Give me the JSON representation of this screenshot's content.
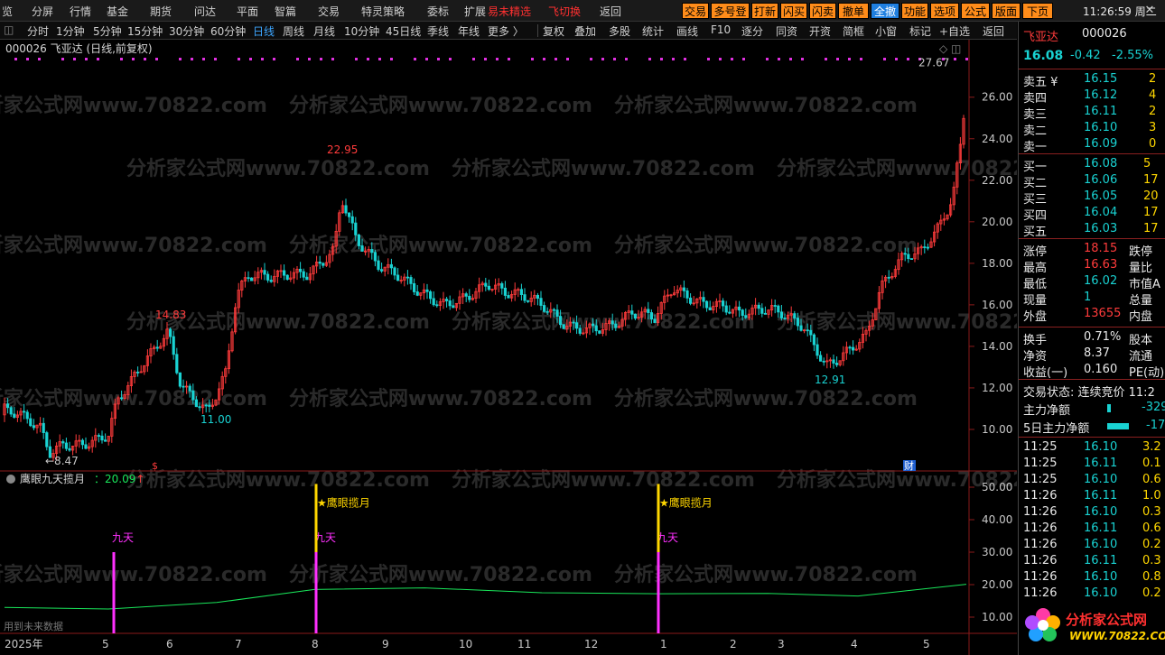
{
  "menu": {
    "items": [
      "览",
      "分屏",
      "行情",
      "基金",
      "期货",
      "问达",
      "平面",
      "智篇",
      "交易",
      "特灵策略",
      "委标",
      "扩展",
      "易未精选",
      "飞切换",
      "返回"
    ],
    "right_buttons": [
      "交易",
      "多号登",
      "打新",
      "闪买",
      "闪卖",
      "撤单",
      "全撤",
      "功能",
      "选项",
      "公式",
      "版面",
      "下页"
    ],
    "clock": "11:26:59 周二"
  },
  "periods": [
    "分时",
    "1分钟",
    "5分钟",
    "15分钟",
    "30分钟",
    "60分钟",
    "日线",
    "周线",
    "月线",
    "10分钟",
    "45日线",
    "季线",
    "年线",
    "更多 〉"
  ],
  "active_period": "日线",
  "tools": [
    "复权",
    "叠加",
    "多股",
    "统计",
    "画线",
    "F10",
    "逐分",
    "同资",
    "开资",
    "简框",
    "小窗",
    "标记",
    "+自选",
    "返回"
  ],
  "chart_title": "000026 飞亚达 (日线,前复权)",
  "chart_data": {
    "type": "candlestick",
    "yaxis_ticks": [
      10,
      12,
      14,
      16,
      18,
      20,
      22,
      24,
      26
    ],
    "ylim": [
      8.0,
      27.9
    ],
    "annotations": [
      {
        "label": "←8.47",
        "value": 8.47
      },
      {
        "label": "14.83",
        "value": 14.83
      },
      {
        "label": "11.00",
        "value": 11.0
      },
      {
        "label": "22.95",
        "value": 22.95
      },
      {
        "label": "12.91",
        "value": 12.91
      },
      {
        "label": "27.67",
        "value": 27.67
      }
    ],
    "indicator": {
      "name": "鹰眼九天揽月",
      "value": "20.09",
      "yaxis_ticks": [
        10,
        20,
        30,
        40,
        50
      ],
      "ylim": [
        5,
        55
      ],
      "signals": [
        {
          "label": "九天",
          "tag": ""
        },
        {
          "label": "九天",
          "tag": "★鹰眼揽月"
        },
        {
          "label": "九天",
          "tag": "★鹰眼揽月"
        }
      ],
      "footnote": "用到未来数据"
    },
    "xaxis_labels": [
      "2025年",
      "5",
      "6",
      "7",
      "8",
      "9",
      "10",
      "11",
      "12",
      "1",
      "2",
      "3",
      "4",
      "5"
    ],
    "markers": [
      "$",
      "财"
    ]
  },
  "watermark": "分析家公式网www.70822.com",
  "quote": {
    "name": "飞亚达",
    "code": "000026",
    "price": "16.08",
    "change": "-0.42",
    "pct": "-2.55%",
    "asks": [
      {
        "label": "卖五 ¥",
        "price": "16.15",
        "vol": "2"
      },
      {
        "label": "卖四",
        "price": "16.12",
        "vol": "4"
      },
      {
        "label": "卖三",
        "price": "16.11",
        "vol": "2"
      },
      {
        "label": "卖二",
        "price": "16.10",
        "vol": "3"
      },
      {
        "label": "卖一",
        "price": "16.09",
        "vol": "0"
      }
    ],
    "bids": [
      {
        "label": "买一",
        "price": "16.08",
        "vol": "5"
      },
      {
        "label": "买二",
        "price": "16.06",
        "vol": "17"
      },
      {
        "label": "买三",
        "price": "16.05",
        "vol": "20"
      },
      {
        "label": "买四",
        "price": "16.04",
        "vol": "17"
      },
      {
        "label": "买五",
        "price": "16.03",
        "vol": "17"
      }
    ],
    "stats": [
      {
        "k": "涨停",
        "v": "18.15",
        "k2": "跌停"
      },
      {
        "k": "最高",
        "v": "16.63",
        "k2": "量比"
      },
      {
        "k": "最低",
        "v": "16.02",
        "k2": "市值A"
      },
      {
        "k": "现量",
        "v": "1",
        "k2": "总量"
      },
      {
        "k": "外盘",
        "v": "13655",
        "k2": "内盘"
      }
    ],
    "fin": [
      {
        "k": "换手",
        "v": "0.71%",
        "k2": "股本"
      },
      {
        "k": "净资",
        "v": "8.37",
        "k2": "流通"
      },
      {
        "k": "收益(一)",
        "v": "0.160",
        "k2": "PE(动)"
      }
    ],
    "trade_status": "交易状态: 连续竞价 11:2",
    "main_flow": {
      "label": "主力净额",
      "v": "-329"
    },
    "main_flow5": {
      "label": "5日主力净额",
      "v": "-17"
    },
    "ticks": [
      {
        "t": "11:25",
        "p": "16.10",
        "v": "3.2"
      },
      {
        "t": "11:25",
        "p": "16.11",
        "v": "0.1"
      },
      {
        "t": "11:25",
        "p": "16.10",
        "v": "0.6"
      },
      {
        "t": "11:26",
        "p": "16.11",
        "v": "1.0"
      },
      {
        "t": "11:26",
        "p": "16.10",
        "v": "0.3"
      },
      {
        "t": "11:26",
        "p": "16.11",
        "v": "0.6"
      },
      {
        "t": "11:26",
        "p": "16.10",
        "v": "0.2"
      },
      {
        "t": "11:26",
        "p": "16.11",
        "v": "0.3"
      },
      {
        "t": "11:26",
        "p": "16.10",
        "v": "0.8"
      },
      {
        "t": "11:26",
        "p": "16.10",
        "v": "0.2"
      }
    ]
  },
  "logo": {
    "title": "分析家公式网",
    "url": "WWW.70822.COM"
  }
}
